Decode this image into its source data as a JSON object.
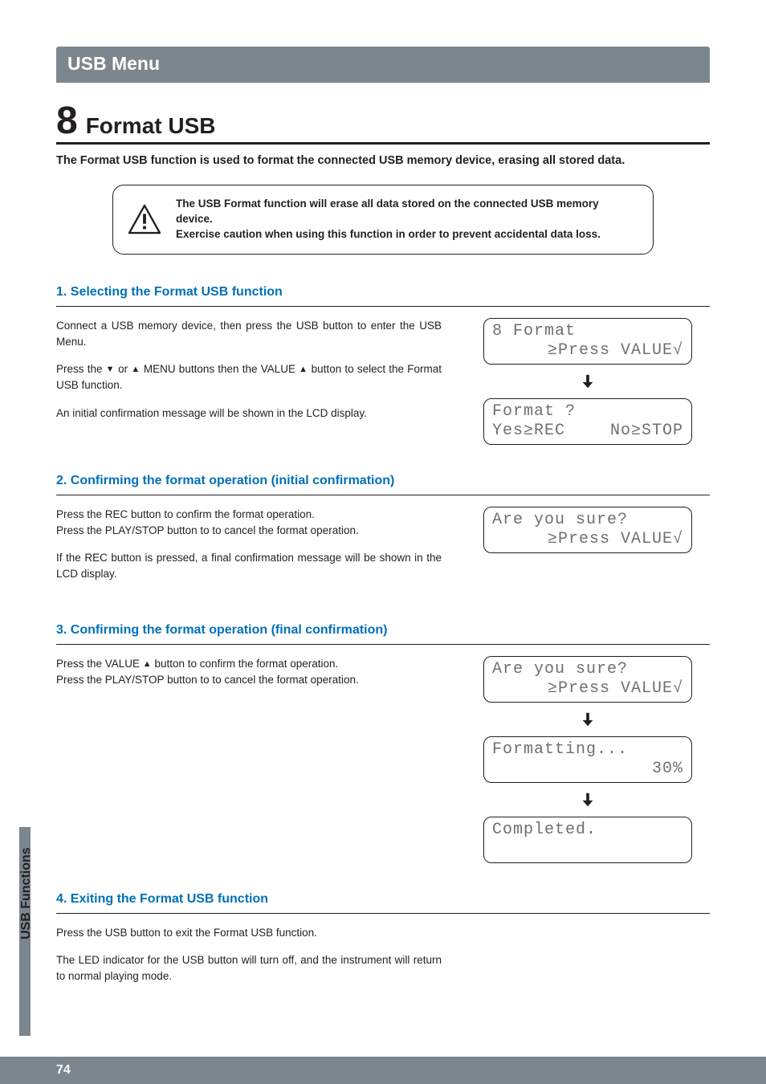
{
  "header": {
    "tab": "USB Menu"
  },
  "chapter": {
    "number": "8",
    "title": "Format USB"
  },
  "lead": "The Format USB function is used to format the connected USB memory device, erasing all stored data.",
  "warning": {
    "line1": "The USB Format function will erase all data stored on the connected USB memory device.",
    "line2": "Exercise caution when using this function in order to prevent accidental data loss."
  },
  "steps": {
    "s1": {
      "title": "1. Selecting the Format USB function",
      "p1": "Connect a USB memory device, then press the USB button to enter the USB Menu.",
      "p2_a": "Press the ",
      "p2_b": " or ",
      "p2_c": " MENU buttons then the VALUE ",
      "p2_d": " button to select the Format USB function.",
      "p3": "An initial confirmation message will be shown in the LCD display.",
      "lcd1": {
        "line1": "8 Format",
        "line2": "≥Press VALUE√"
      },
      "lcd2": {
        "line1": "Format ?",
        "line2a": "Yes≥REC",
        "line2b": "No≥STOP"
      }
    },
    "s2": {
      "title": "2. Confirming the format operation (initial confirmation)",
      "p1": "Press the REC button to confirm the format operation.",
      "p2": "Press the PLAY/STOP button to to cancel the format operation.",
      "p3": "If the REC button is pressed, a final confirmation message will be shown in the LCD display.",
      "lcd": {
        "line1": "Are you sure?",
        "line2": "≥Press VALUE√"
      }
    },
    "s3": {
      "title": "3. Confirming the format operation (final confirmation)",
      "p1_a": "Press the VALUE ",
      "p1_b": " button to confirm the format operation.",
      "p2": "Press the PLAY/STOP button to to cancel the format operation.",
      "lcd1": {
        "line1": "Are you sure?",
        "line2": "≥Press VALUE√"
      },
      "lcd2": {
        "line1": "Formatting...",
        "line2": "30%"
      },
      "lcd3": {
        "line1": "Completed.",
        "line2": " "
      }
    },
    "s4": {
      "title": "4. Exiting the Format USB function",
      "p1": "Press the USB button to exit the Format USB function.",
      "p2": "The LED indicator for the USB button will turn off, and the instrument will return to normal playing mode."
    }
  },
  "side": {
    "label": "USB Functions"
  },
  "footer": {
    "page": "74"
  },
  "glyphs": {
    "up": "▲",
    "down": "▼"
  }
}
